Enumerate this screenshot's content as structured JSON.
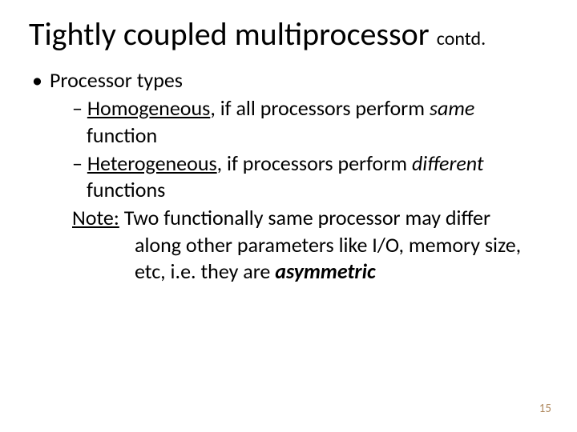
{
  "title": {
    "main": "Tightly coupled multiprocessor ",
    "suffix": "contd."
  },
  "bullet1": "Processor types",
  "sub1": {
    "dash": "– ",
    "term": "Homogeneous",
    "rest1": ", if all processors perform ",
    "same": "same",
    "rest2": " function"
  },
  "sub2": {
    "dash": "– ",
    "term": "Heterogeneous",
    "rest1": ", if processors perform ",
    "different": "different",
    "rest2": " functions"
  },
  "note": {
    "label": "Note:",
    "line1": " Two functionally same processor may differ",
    "line2a": "along other parameters like  I/O, memory size,",
    "line2b": "etc, i.e. they are ",
    "asym": "asymmetric"
  },
  "page": "15"
}
